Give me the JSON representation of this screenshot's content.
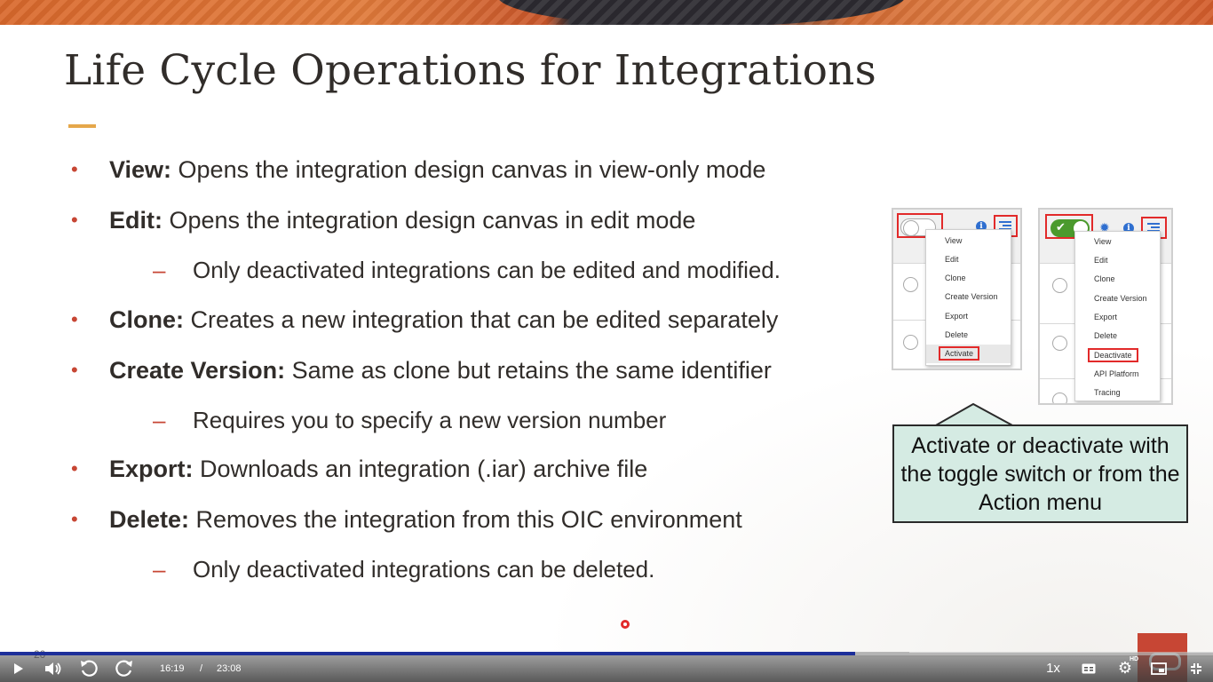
{
  "slide": {
    "title": "Life Cycle Operations for Integrations",
    "bullets": [
      {
        "term": "View:",
        "text": " Opens the integration design canvas in view-only mode"
      },
      {
        "term": "Edit:",
        "text": " Opens the integration design canvas in edit mode"
      },
      {
        "term": "Clone:",
        "text": " Creates a new integration that can be edited separately"
      },
      {
        "term": "Create Version:",
        "text": " Same as clone but retains the same identifier"
      },
      {
        "term": "Export:",
        "text": " Downloads an integration (.iar) archive file"
      },
      {
        "term": "Delete:",
        "text": " Removes the integration from this OIC environment"
      }
    ],
    "subs": [
      "Only deactivated integrations can be edited and modified.",
      "Requires you to specify a new version number",
      "Only deactivated integrations can be deleted."
    ],
    "slide_number": "20"
  },
  "screenshot_left": {
    "menu": [
      "View",
      "Edit",
      "Clone",
      "Create Version",
      "Export",
      "Delete",
      "Activate"
    ],
    "highlighted": "Activate"
  },
  "screenshot_right": {
    "menu": [
      "View",
      "Edit",
      "Clone",
      "Create Version",
      "Export",
      "Delete",
      "Deactivate",
      "API Platform",
      "Tracing"
    ],
    "highlighted": "Deactivate"
  },
  "callout": {
    "text": "Activate or deactivate with the toggle switch or from the Action menu"
  },
  "player": {
    "current_time": "16:19",
    "separator": "/",
    "duration": "23:08",
    "speed": "1x",
    "progress_fraction": 0.705,
    "buffer_fraction": 0.75,
    "hd_label": "HD",
    "colors": {
      "progress": "#1d2f9a",
      "accent": "#c74634"
    }
  }
}
